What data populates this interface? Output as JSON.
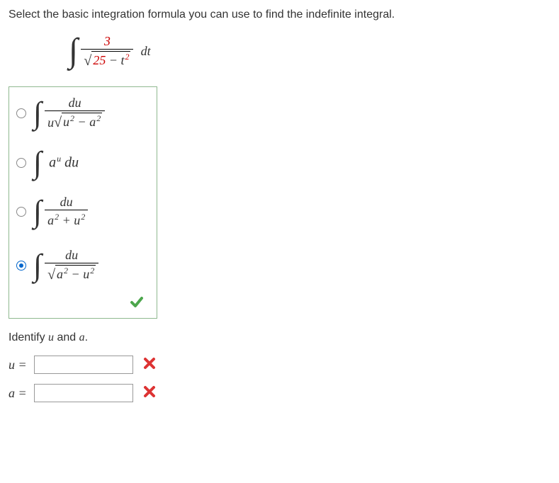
{
  "question_text": "Select the basic integration formula you can use to find the indefinite integral.",
  "problem": {
    "numerator": "3",
    "sqrt_const": "25",
    "sqrt_var": "t",
    "diff": "dt"
  },
  "options": {
    "opt1": {
      "num": "du",
      "pre_sqrt": "u",
      "sqrt_left": "u",
      "sqrt_right": "a"
    },
    "opt2": {
      "base": "a",
      "exp": "u",
      "diff": "du"
    },
    "opt3": {
      "num": "du",
      "left": "a",
      "right": "u"
    },
    "opt4": {
      "num": "du",
      "sqrt_left": "a",
      "sqrt_right": "u"
    }
  },
  "selected_option": 4,
  "options_correct": true,
  "identify_text": "Identify u and a.",
  "inputs": {
    "u": {
      "label": "u =",
      "value": "",
      "correct": false
    },
    "a": {
      "label": "a =",
      "value": "",
      "correct": false
    }
  }
}
